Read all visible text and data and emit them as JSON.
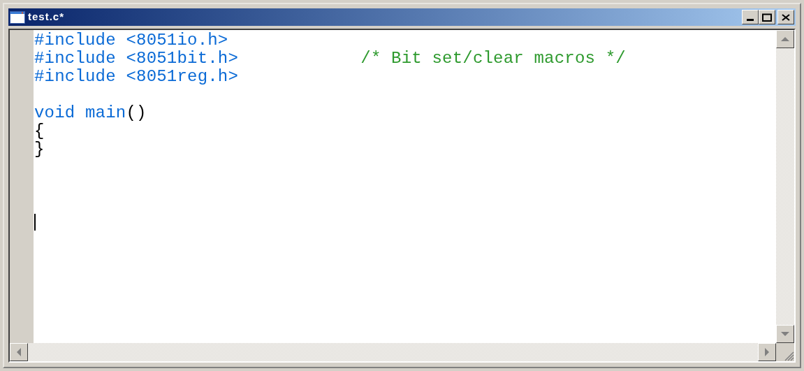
{
  "window": {
    "title": "test.c*"
  },
  "editor": {
    "lines": [
      {
        "kind": "code",
        "tokens": [
          {
            "kind": "keyword",
            "text": "#include <8051io.h>"
          }
        ]
      },
      {
        "kind": "code",
        "tokens": [
          {
            "kind": "keyword",
            "text": "#include <8051bit.h>            "
          },
          {
            "kind": "comment",
            "text": "/* Bit set/clear macros */"
          }
        ]
      },
      {
        "kind": "code",
        "tokens": [
          {
            "kind": "keyword",
            "text": "#include <8051reg.h>"
          }
        ]
      },
      {
        "kind": "blank"
      },
      {
        "kind": "code",
        "tokens": [
          {
            "kind": "keyword",
            "text": "void main"
          },
          {
            "kind": "plain",
            "text": "()"
          }
        ]
      },
      {
        "kind": "code",
        "tokens": [
          {
            "kind": "plain",
            "text": "{"
          }
        ]
      },
      {
        "kind": "code",
        "tokens": [
          {
            "kind": "plain",
            "text": "}"
          }
        ]
      },
      {
        "kind": "blank"
      },
      {
        "kind": "blank"
      },
      {
        "kind": "blank"
      },
      {
        "kind": "cursor"
      }
    ]
  }
}
